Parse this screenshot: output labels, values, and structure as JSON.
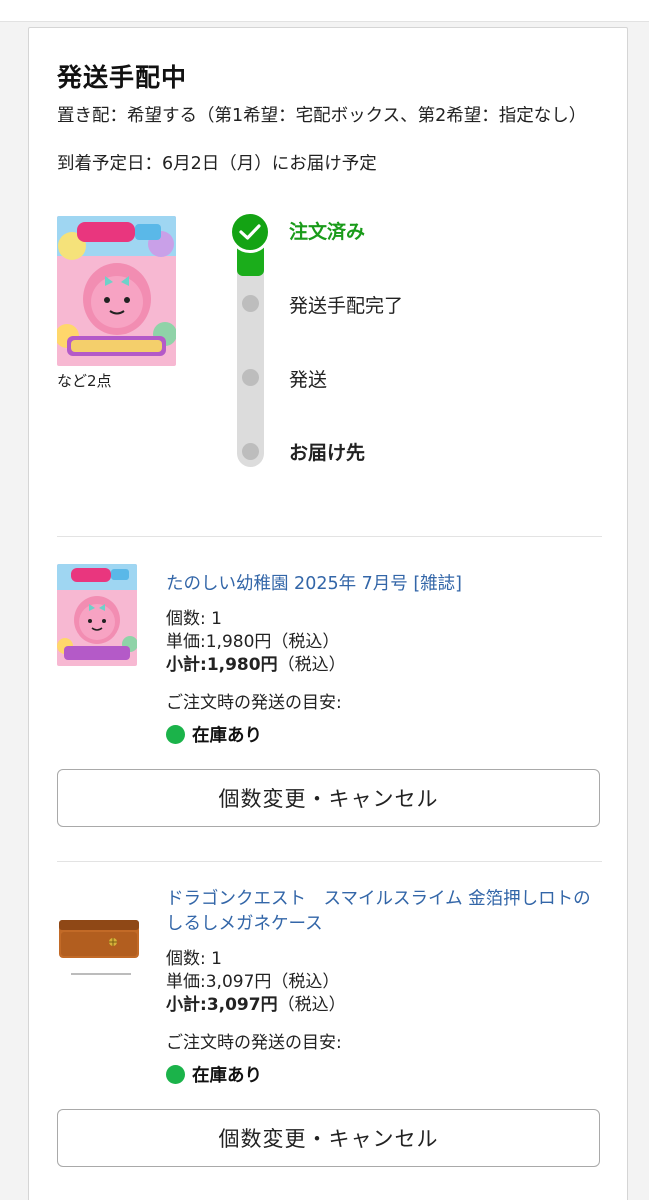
{
  "header": {
    "title": "発送手配中",
    "okihai": "置き配：希望する（第1希望：宅配ボックス、第2希望：指定なし）",
    "arrival": "到着予定日：6月2日（月）にお届け予定"
  },
  "summary": {
    "items_caption": "など2点"
  },
  "tracker": {
    "steps": [
      {
        "label": "注文済み",
        "state": "done"
      },
      {
        "label": "発送手配完了",
        "state": "pending"
      },
      {
        "label": "発送",
        "state": "pending"
      },
      {
        "label": "お届け先",
        "state": "pending"
      }
    ],
    "done_color": "#1bad1b"
  },
  "items": [
    {
      "name": "たのしい幼稚園 2025年 7月号 [雑誌]",
      "qty_label": "個数: 1",
      "unit_price_label": "単価:1,980円",
      "unit_price_tax": "（税込）",
      "subtotal_key": "小計:",
      "subtotal_value": "1,980円",
      "subtotal_tax": "（税込）",
      "ship_note": "ご注文時の発送の目安:",
      "stock": "在庫あり",
      "button": "個数変更・キャンセル"
    },
    {
      "name": "ドラゴンクエスト　スマイルスライム 金箔押しロトのしるしメガネケース",
      "qty_label": "個数: 1",
      "unit_price_label": "単価:3,097円",
      "unit_price_tax": "（税込）",
      "subtotal_key": "小計:",
      "subtotal_value": "3,097円",
      "subtotal_tax": "（税込）",
      "ship_note": "ご注文時の発送の目安:",
      "stock": "在庫あり",
      "button": "個数変更・キャンセル"
    }
  ],
  "colors": {
    "link": "#3366a8",
    "in_stock": "#1bb34a"
  }
}
